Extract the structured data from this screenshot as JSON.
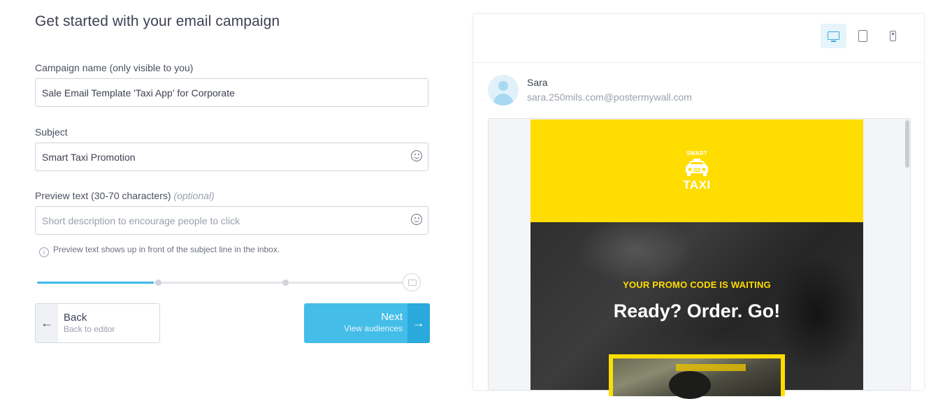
{
  "form": {
    "title": "Get started with your email campaign",
    "campaign_name": {
      "label": "Campaign name (only visible to you)",
      "value": "Sale Email Template 'Taxi App' for Corporate"
    },
    "subject": {
      "label": "Subject",
      "value": "Smart Taxi Promotion"
    },
    "preview_text": {
      "label": "Preview text (30-70 characters)",
      "optional": "(optional)",
      "placeholder": "Short description to encourage people to click",
      "hint": "Preview text shows up in front of the subject line in the inbox.",
      "info_icon": "i"
    }
  },
  "progress": {
    "steps": 4,
    "current_step": 1,
    "accent": "#3fb6e5"
  },
  "buttons": {
    "back": {
      "label": "Back",
      "sublabel": "Back to editor",
      "icon": "arrow-left",
      "glyph": "←"
    },
    "next": {
      "label": "Next",
      "sublabel": "View audiences",
      "icon": "arrow-right",
      "glyph": "→",
      "color": "#44bde8"
    }
  },
  "preview": {
    "device_selected": "desktop",
    "devices": [
      "desktop",
      "tablet",
      "mobile"
    ],
    "sender": {
      "name": "Sara",
      "email": "sara.250mils.com@postermywall.com"
    },
    "email": {
      "logo_top": "SMART",
      "logo_bottom": "TAXI",
      "promo": "YOUR PROMO CODE IS WAITING",
      "headline": "Ready? Order. Go!",
      "brand_color": "#ffdd00"
    }
  }
}
